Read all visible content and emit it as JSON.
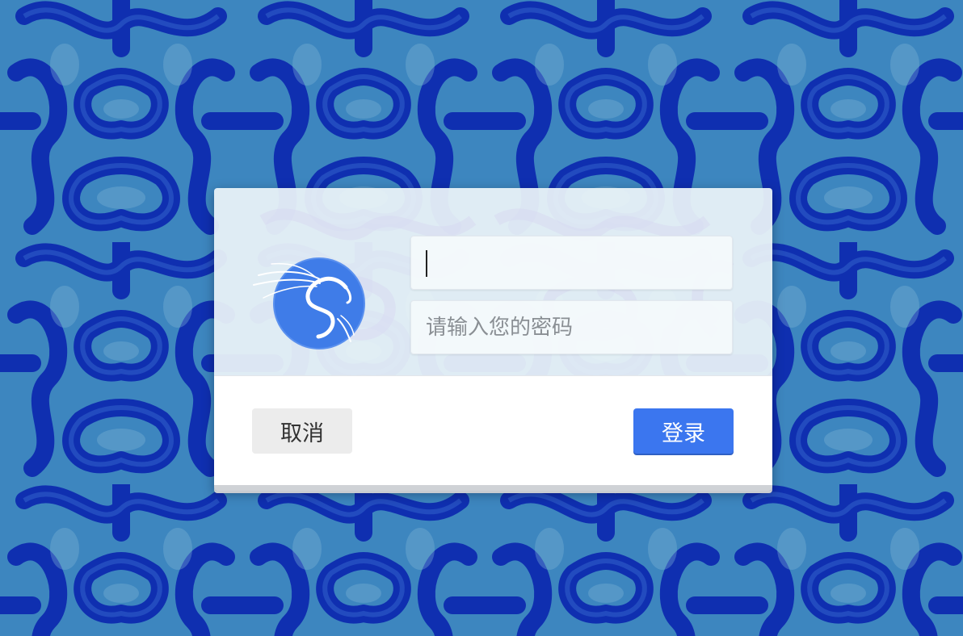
{
  "login_dialog": {
    "username_value": "",
    "password_placeholder": "请输入您的密码",
    "cancel_label": "取消",
    "login_label": "登录",
    "logo_icon": "kali-dragon-icon"
  },
  "colors": {
    "wallpaper_primary": "#3d86bf",
    "wallpaper_dark": "#0b22a8",
    "login_button": "#3b76ef",
    "cancel_button": "#ececec",
    "logo_circle": "#3f7ce8"
  }
}
